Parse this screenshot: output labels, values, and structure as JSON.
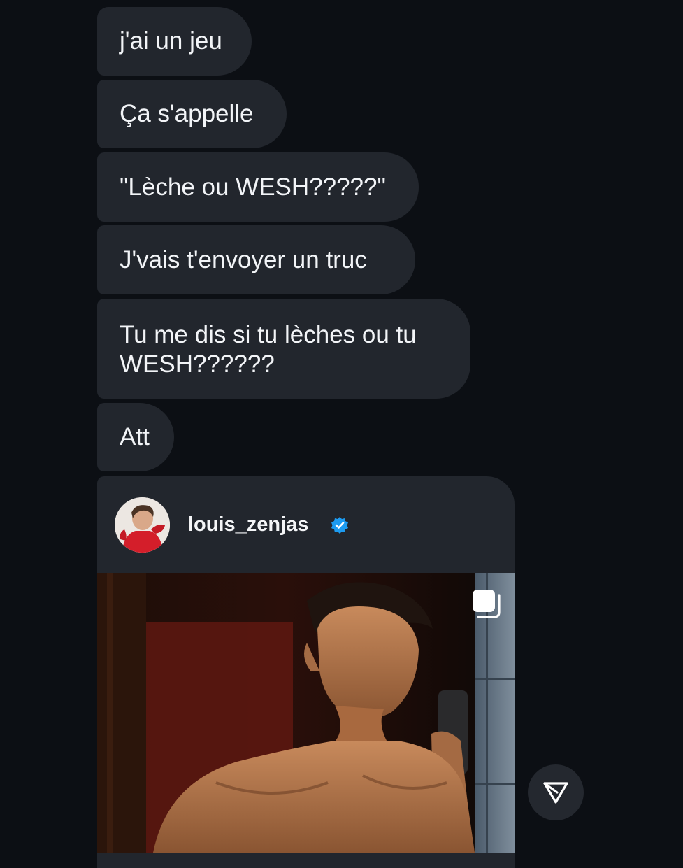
{
  "messages": [
    {
      "text": "j'ai un jeu"
    },
    {
      "text": "Ça s'appelle"
    },
    {
      "text": "\"Lèche ou WESH?????\""
    },
    {
      "text": "J'vais t'envoyer un truc"
    },
    {
      "text": "Tu me dis si tu lèches ou tu WESH??????"
    },
    {
      "text": "Att"
    }
  ],
  "shared_post": {
    "username": "louis_zenjas",
    "verified": true,
    "icons": {
      "avatar": "profile-avatar",
      "verified": "verified-badge-icon",
      "carousel": "multiple-photos-icon"
    },
    "colors": {
      "verified_badge": "#1d9bf0"
    }
  },
  "actions": {
    "share_icon": "send-icon"
  },
  "colors": {
    "background": "#0c0f14",
    "bubble": "#22262d",
    "text": "#f2f4f7"
  }
}
